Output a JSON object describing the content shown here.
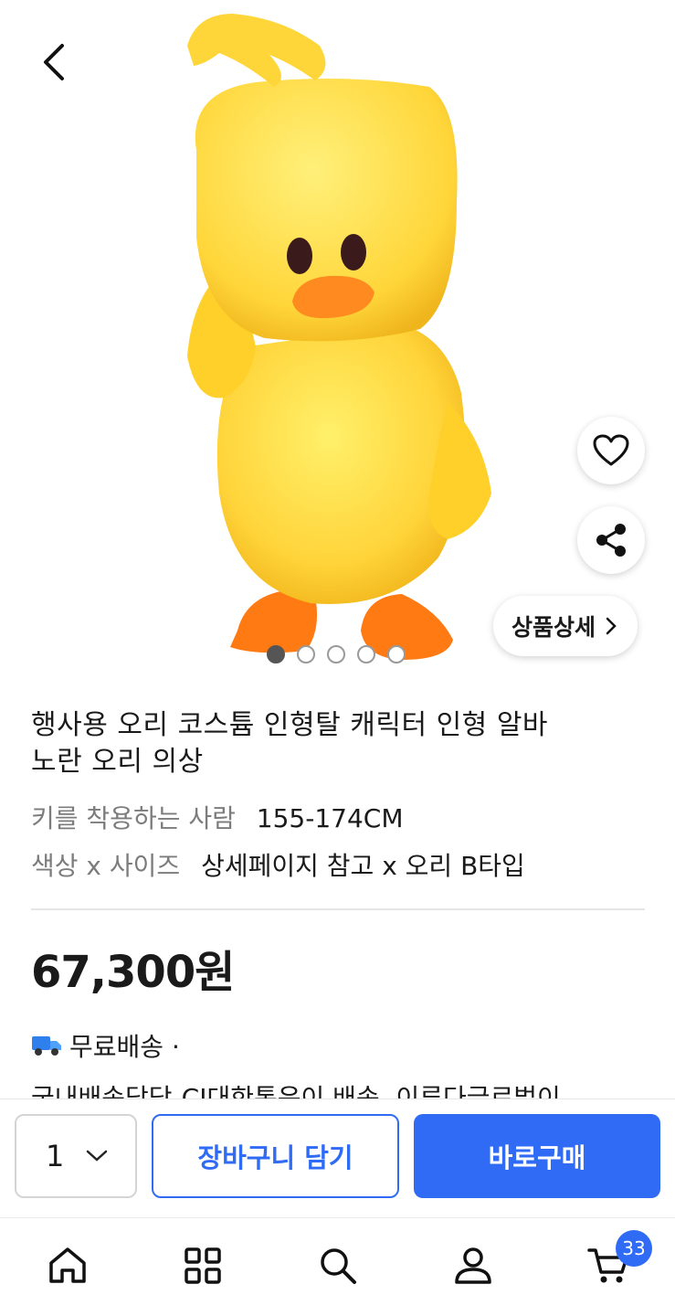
{
  "product": {
    "title_line1": "행사용 오리 코스튬 인형탈 캐릭터 인형 알바",
    "title_line2": "노란 오리 의상",
    "options": [
      {
        "label": "키를 착용하는 사람",
        "value": "155-174CM"
      },
      {
        "label": "색상 x 사이즈",
        "value": "상세페이지 참고 x 오리 B타입"
      }
    ],
    "price": "67,300원",
    "shipping": "무료배송 ·",
    "shipping_detail": "국내배송담당-CJ대한통운이 배송, 이루다글로벌이"
  },
  "gallery": {
    "detail_label": "상품상세",
    "image_count": 5,
    "active_index": 0
  },
  "buy_bar": {
    "quantity": "1",
    "cart_label": "장바구니 담기",
    "buy_label": "바로구매"
  },
  "tabbar": {
    "cart_badge": "33"
  },
  "colors": {
    "accent": "#2f6bf5",
    "duck_yellow": "#ffd43a",
    "beak_orange": "#ff8a1f"
  }
}
